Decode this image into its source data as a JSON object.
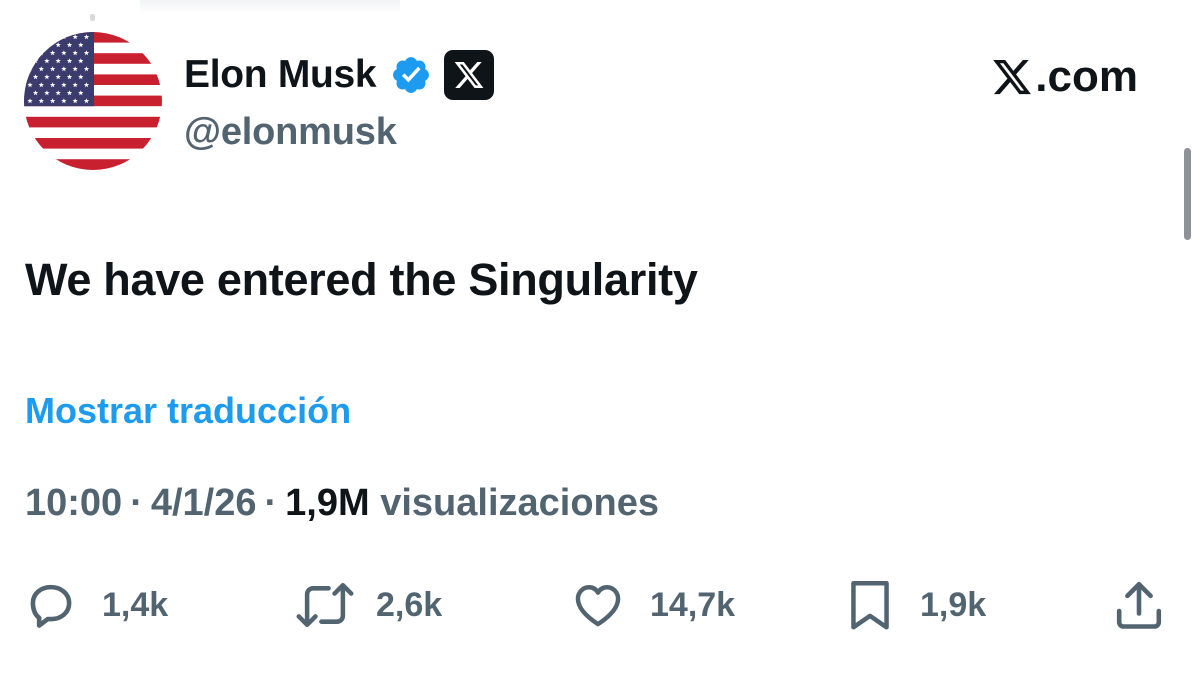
{
  "author": {
    "name": "Elon Musk",
    "handle": "@elonmusk",
    "avatar_icon": "us-flag-avatar",
    "verified_badge_color": "#1d9bf0",
    "affiliate_badge": "x-logo-badge"
  },
  "site_label": ".com",
  "site_logo_icon": "x-logo-icon",
  "tweet": {
    "text": "We have entered the Singularity",
    "translate_link": "Mostrar traducción"
  },
  "meta": {
    "time": "10:00",
    "separator": "·",
    "date": "4/1/26",
    "views_count": "1,9M",
    "views_label": "visualizaciones"
  },
  "actions": {
    "replies": "1,4k",
    "reposts": "2,6k",
    "likes": "14,7k",
    "bookmarks": "1,9k"
  },
  "colors": {
    "text": "#0f1419",
    "secondary": "#536471",
    "link": "#1d9bf0"
  }
}
